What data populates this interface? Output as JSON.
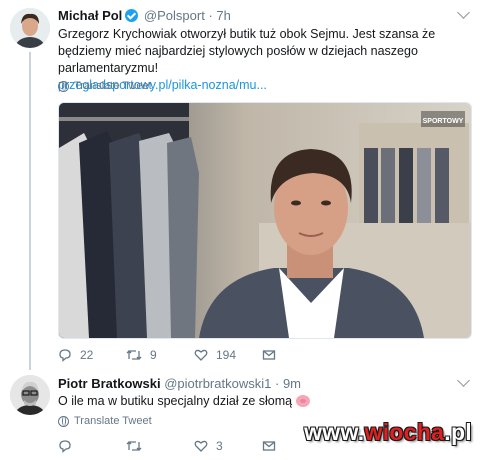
{
  "tweet1": {
    "name": "Michał Pol",
    "handle": "@Polsport",
    "dot": "·",
    "time": "7h",
    "text": "Grzegorz Krychowiak otworzył butik tuż obok Sejmu.  Jest szansa że będziemy mieć najbardziej stylowych posłów w dziejach naszego parlamentaryzmu!",
    "link": "przegladsportowy.pl/pilka-nozna/mu...",
    "translate": "Translate Tweet",
    "media_logo": "SPORTOWY",
    "replies": "22",
    "retweets": "9",
    "likes": "194"
  },
  "tweet2": {
    "name": "Piotr Bratkowski",
    "handle": "@piotrbratkowski1",
    "dot": "·",
    "time": "9m",
    "text": "O ile ma w butiku specjalny dział ze słomą",
    "translate": "Translate Tweet",
    "replies": "",
    "retweets": "",
    "likes": "3"
  },
  "watermark": {
    "prefix": "www.",
    "brand": "wiocha",
    "suffix": ".pl"
  },
  "colors": {
    "link": "#1b95e0",
    "verified": "#1da1f2",
    "meta": "#657786",
    "watermark_red": "#e02020"
  },
  "icons": [
    "verified-badge-icon",
    "chevron-down-icon",
    "globe-icon",
    "reply-icon",
    "retweet-icon",
    "like-icon",
    "share-icon",
    "pig-emoji-icon"
  ]
}
